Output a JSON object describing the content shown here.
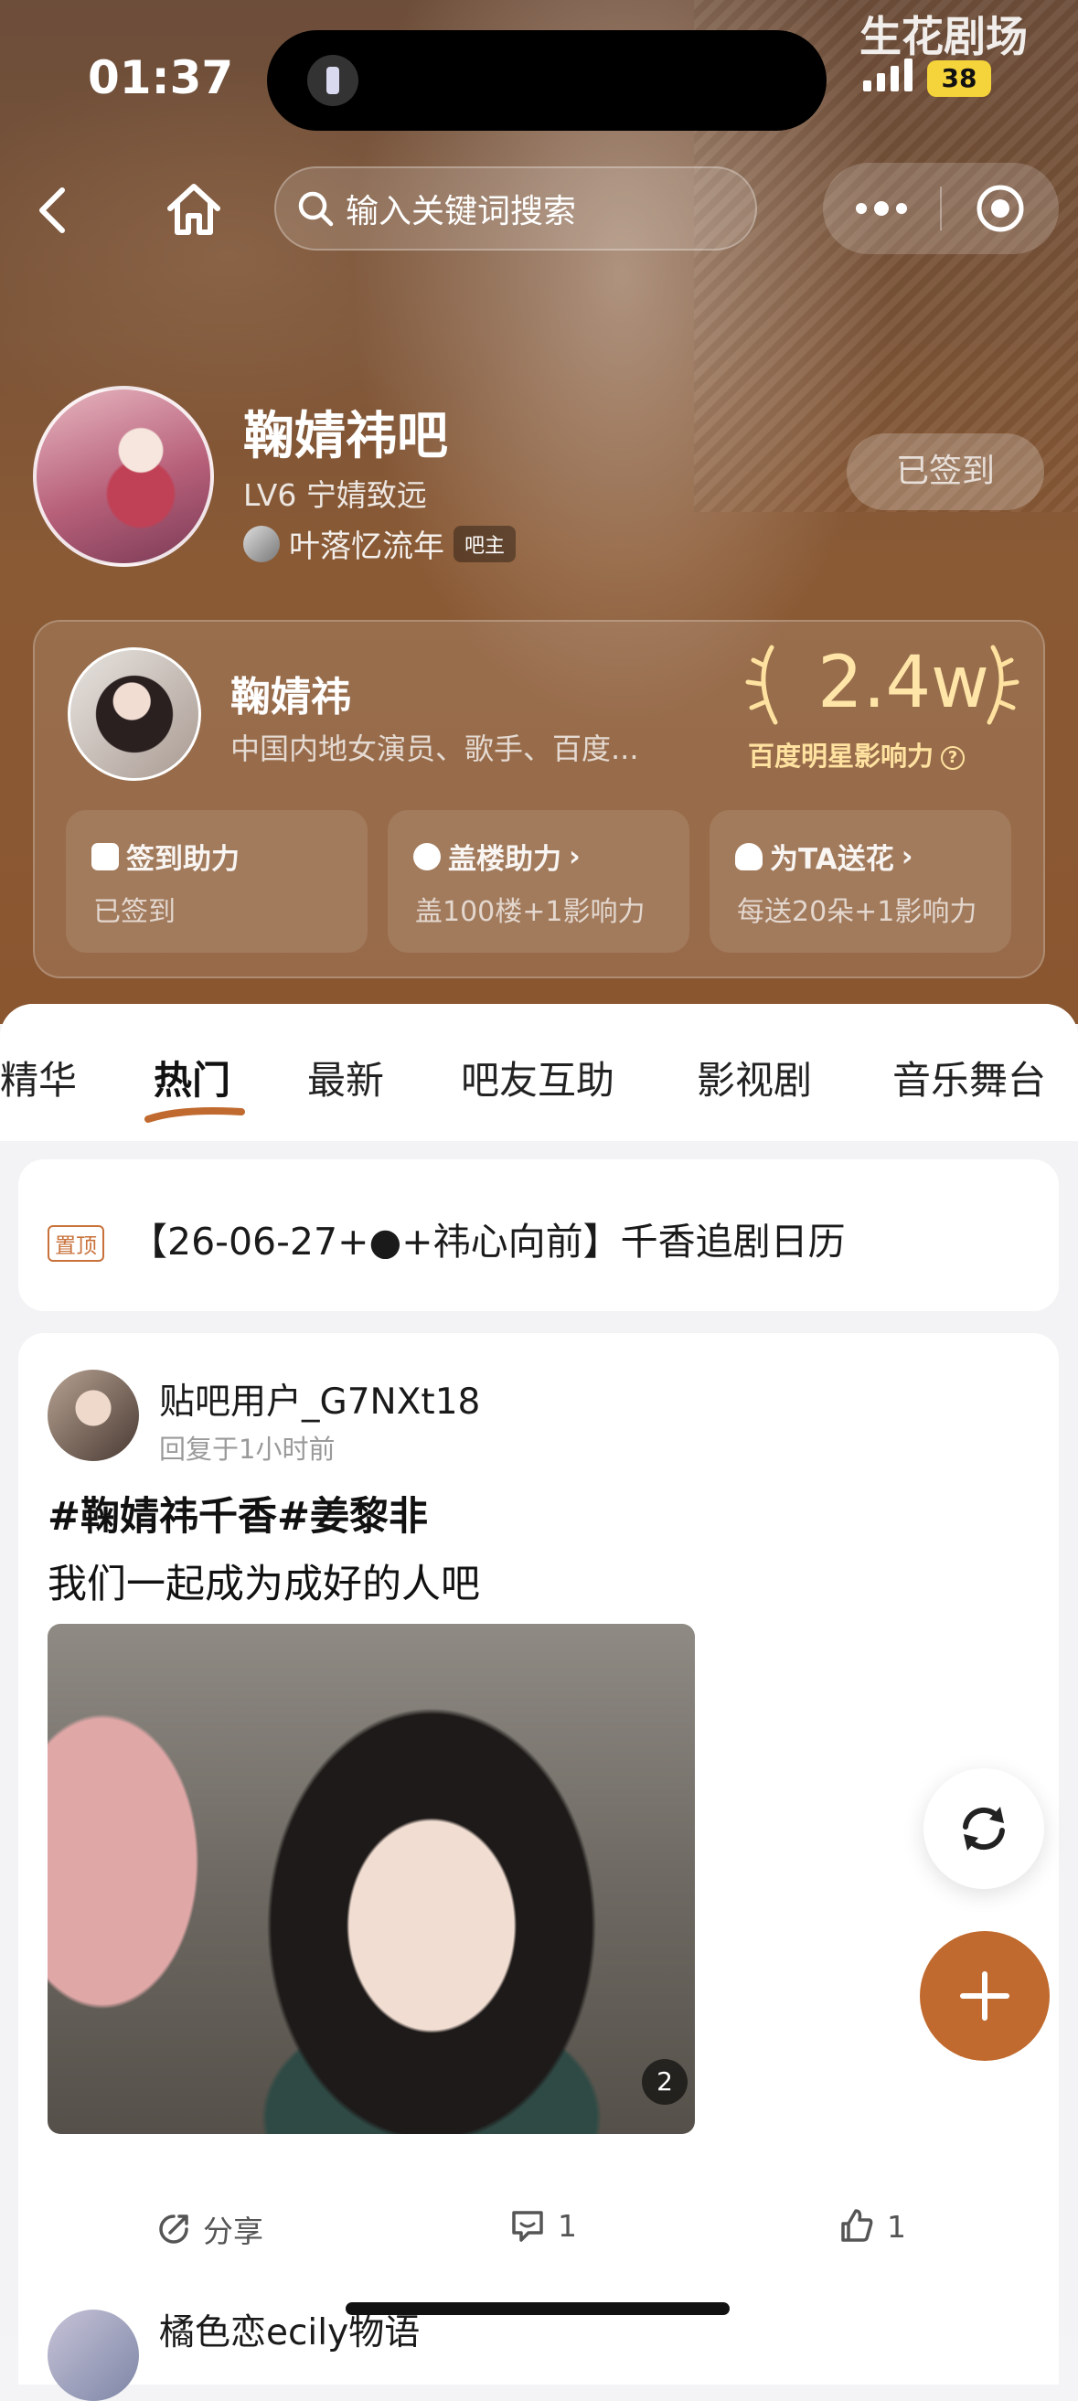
{
  "status_bar": {
    "time": "01:37",
    "battery": "38",
    "watermark": "生花剧场"
  },
  "nav": {
    "search_placeholder": "输入关键词搜索"
  },
  "forum": {
    "name": "鞠婧祎吧",
    "level": "LV6 宁婧致远",
    "owner_name": "叶落忆流年",
    "owner_badge": "吧主",
    "signed_label": "已签到"
  },
  "star_card": {
    "name": "鞠婧祎",
    "description": "中国内地女演员、歌手、百度...",
    "influence_value": "2.4w",
    "influence_label": "百度明星影响力",
    "actions": [
      {
        "title": "签到助力",
        "subtitle": "已签到",
        "has_arrow": false
      },
      {
        "title": "盖楼助力",
        "subtitle": "盖100楼+1影响力",
        "has_arrow": true
      },
      {
        "title": "为TA送花",
        "subtitle": "每送20朵+1影响力",
        "has_arrow": true
      }
    ]
  },
  "tabs": [
    "精华",
    "热门",
    "最新",
    "吧友互助",
    "影视剧",
    "音乐舞台"
  ],
  "active_tab": "热门",
  "pinned": {
    "badge": "置顶",
    "title": "【26-06-27+●+祎心向前】千香追剧日历"
  },
  "post": {
    "username": "贴吧用户_G7NXt18",
    "time": "回复于1小时前",
    "tags": "#鞠婧祎千香#姜黎非",
    "text": "我们一起成为成好的人吧",
    "image_count": "2",
    "share_label": "分享",
    "comment_count": "1",
    "like_count": "1"
  },
  "next_post": {
    "username": "橘色恋ecily物语"
  },
  "colors": {
    "accent": "#c06a2f",
    "hero_bg": "#7a5337",
    "gold": "#ffe2a0"
  }
}
